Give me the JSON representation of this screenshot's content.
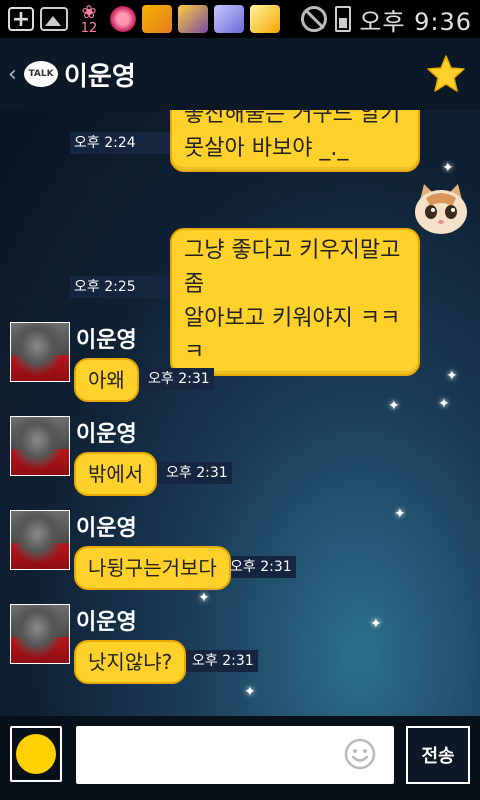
{
  "status_bar": {
    "time": "오후 9:36",
    "notification_badge": "12",
    "icons": [
      "add-icon",
      "gallery-icon",
      "bow-icon",
      "rose-icon",
      "app-icon",
      "app-icon",
      "app-icon",
      "app-icon",
      "no-sim-icon",
      "battery-icon"
    ]
  },
  "header": {
    "app_logo": "TALK",
    "title": "이운영",
    "accent": "#ffd12a"
  },
  "messages": [
    {
      "id": 1,
      "direction": "out",
      "lines": [
        "좋진해줄는 거구드 알기",
        "못살아 바보야 _._"
      ],
      "time": "오후 2:24"
    },
    {
      "id": 2,
      "direction": "out",
      "lines": [
        "그냥 좋다고 키우지말고 좀",
        "알아보고 키워야지 ㅋㅋㅋ"
      ],
      "time": "오후 2:25"
    },
    {
      "id": 3,
      "direction": "in",
      "sender": "이운영",
      "text": "아왜",
      "time": "오후 2:31"
    },
    {
      "id": 4,
      "direction": "in",
      "sender": "이운영",
      "text": "밖에서",
      "time": "오후 2:31"
    },
    {
      "id": 5,
      "direction": "in",
      "sender": "이운영",
      "text": "나뒹구는거보다",
      "time": "오후 2:31"
    },
    {
      "id": 6,
      "direction": "in",
      "sender": "이운영",
      "text": "낫지않냐?",
      "time": "오후 2:31"
    }
  ],
  "input": {
    "value": "",
    "placeholder": "",
    "send_label": "전송"
  },
  "colors": {
    "bubble": "#ffd12a",
    "bubble_border": "#e8a900",
    "timestamp_bg": "#162640"
  }
}
